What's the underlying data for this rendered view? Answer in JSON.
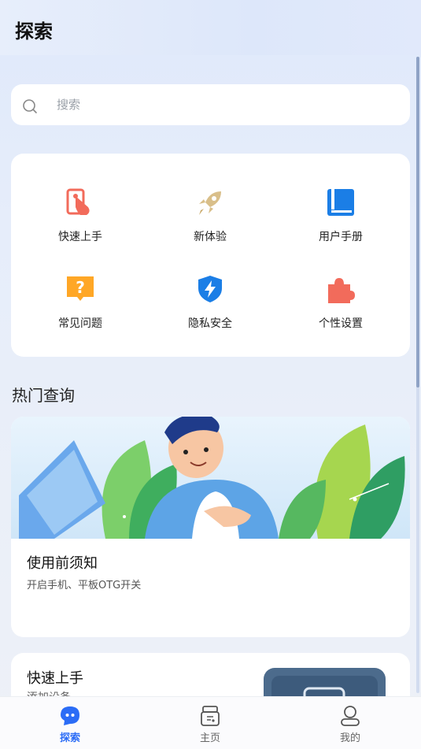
{
  "header": {
    "title": "探索"
  },
  "search": {
    "placeholder": "搜索"
  },
  "grid": {
    "items": [
      {
        "label": "快速上手",
        "icon": "tap-hand-icon",
        "color": "#f26b5b"
      },
      {
        "label": "新体验",
        "icon": "rocket-icon",
        "color": "#d9bf8a"
      },
      {
        "label": "用户手册",
        "icon": "book-icon",
        "color": "#1b7ee6"
      },
      {
        "label": "常见问题",
        "icon": "question-icon",
        "color": "#ffa726"
      },
      {
        "label": "隐私安全",
        "icon": "shield-icon",
        "color": "#1b7ee6"
      },
      {
        "label": "个性设置",
        "icon": "puzzle-icon",
        "color": "#f26b5b"
      }
    ]
  },
  "hot": {
    "section_title": "热门查询",
    "card_title": "使用前须知",
    "card_subtitle": "开启手机、平板OTG开关"
  },
  "quick": {
    "title": "快速上手",
    "subtitle": "添加设备"
  },
  "tabs": [
    {
      "label": "探索",
      "icon": "explore-chat-icon",
      "active": true
    },
    {
      "label": "主页",
      "icon": "device-icon",
      "active": false
    },
    {
      "label": "我的",
      "icon": "user-icon",
      "active": false
    }
  ],
  "colors": {
    "accent": "#2b6cf6"
  }
}
